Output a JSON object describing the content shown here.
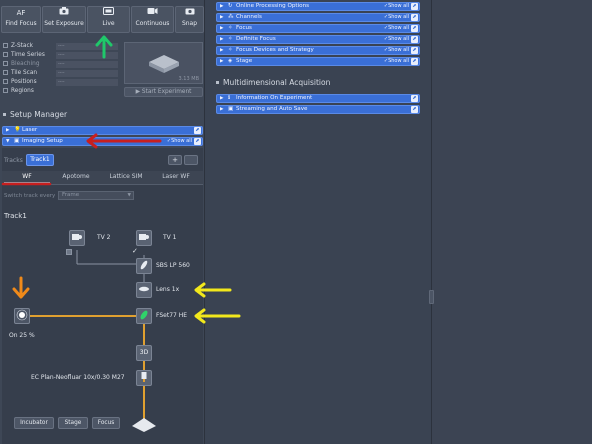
{
  "toolbar": [
    {
      "icon": "AF",
      "label": "Find Focus"
    },
    {
      "icon": "camera-icon",
      "label": "Set Exposure"
    },
    {
      "icon": "live-icon",
      "label": "Live"
    },
    {
      "icon": "video-icon",
      "label": "Continuous"
    },
    {
      "icon": "snap-icon",
      "label": "Snap"
    }
  ],
  "experiment": {
    "options": [
      {
        "label": "Z-Stack",
        "value": "----"
      },
      {
        "label": "Time Series",
        "value": "----"
      },
      {
        "label": "Bleaching",
        "value": "----"
      },
      {
        "label": "Tile Scan",
        "value": "----"
      },
      {
        "label": "Positions",
        "value": "----"
      },
      {
        "label": "Regions",
        "value": ""
      }
    ],
    "file_size": "3.13 MB",
    "start_label": "Start Experiment"
  },
  "setup_manager": {
    "title": "Setup Manager",
    "laser_label": "Laser",
    "imaging_setup_label": "Imaging Setup",
    "show_all": "Show all",
    "tracks_label": "Tracks",
    "track_name": "Track1",
    "plus": "+",
    "tabs": [
      "WF",
      "Apotome",
      "Lattice SIM",
      "Laser WF"
    ],
    "switch_label": "Switch track every",
    "switch_value": "Frame",
    "track_heading": "Track1",
    "tv2": "TV 2",
    "tv1": "TV 1",
    "sbs": "SBS LP 560",
    "lens": "Lens 1x",
    "fset": "FSet77 HE",
    "node_3d": "3D",
    "objective": "EC Plan-Neofluar 10x/0.30 M27",
    "light_source": "On 25 %",
    "bottom_buttons": [
      "Incubator",
      "Stage",
      "Focus"
    ]
  },
  "right_sections": [
    "Online Processing Options",
    "Channels",
    "Focus",
    "Definite Focus",
    "Focus Devices and Strategy",
    "Stage"
  ],
  "multi": {
    "title": "Multidimensional Acquisition",
    "items": [
      "Information On Experiment",
      "Streaming and Auto Save"
    ]
  },
  "colors": {
    "blue_bar": "#3a6fd6",
    "annotation_green": "#1fc86a",
    "annotation_red": "#c81f1f",
    "annotation_yellow": "#f2e81c",
    "annotation_orange": "#f08a1a",
    "light_path": "#e0a030"
  }
}
